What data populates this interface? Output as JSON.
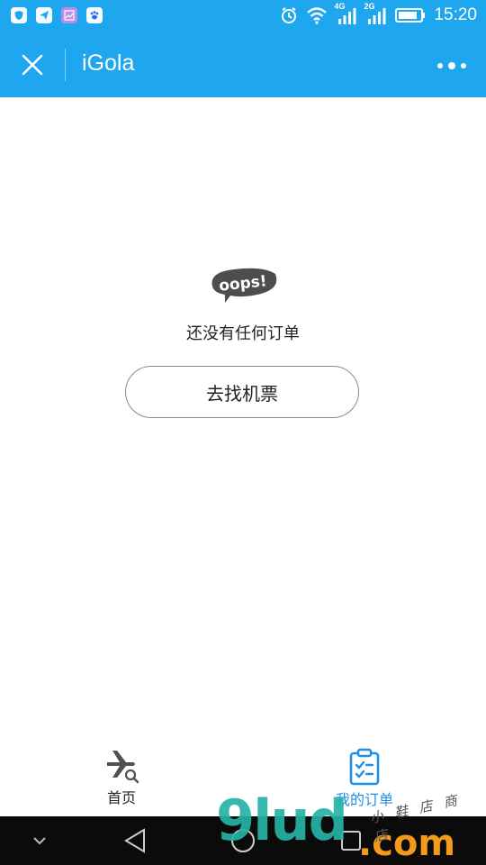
{
  "status_bar": {
    "time": "15:20",
    "network_labels": [
      "4G",
      "2G"
    ],
    "icons": [
      "shield-app-icon",
      "paper-plane-app-icon",
      "photo-app-icon",
      "baidu-paw-app-icon",
      "alarm-icon",
      "wifi-icon",
      "signal-icon",
      "battery-icon"
    ]
  },
  "title_bar": {
    "title": "iGola",
    "background_color": "#1ea6ef"
  },
  "empty_state": {
    "illustration_text": "oops!",
    "message": "还没有任何订单",
    "action_label": "去找机票"
  },
  "tabs": [
    {
      "label": "首页",
      "icon": "plane-search-icon",
      "active": false
    },
    {
      "label": "我的订单",
      "icon": "clipboard-check-icon",
      "active": true
    }
  ],
  "nav_bar": {
    "buttons": [
      "collapse-icon",
      "back-icon",
      "home-icon",
      "recents-icon"
    ]
  },
  "watermark": {
    "brand": "9lud",
    "suffix": ".com",
    "script_text": "小 鞋 店 商 店"
  }
}
